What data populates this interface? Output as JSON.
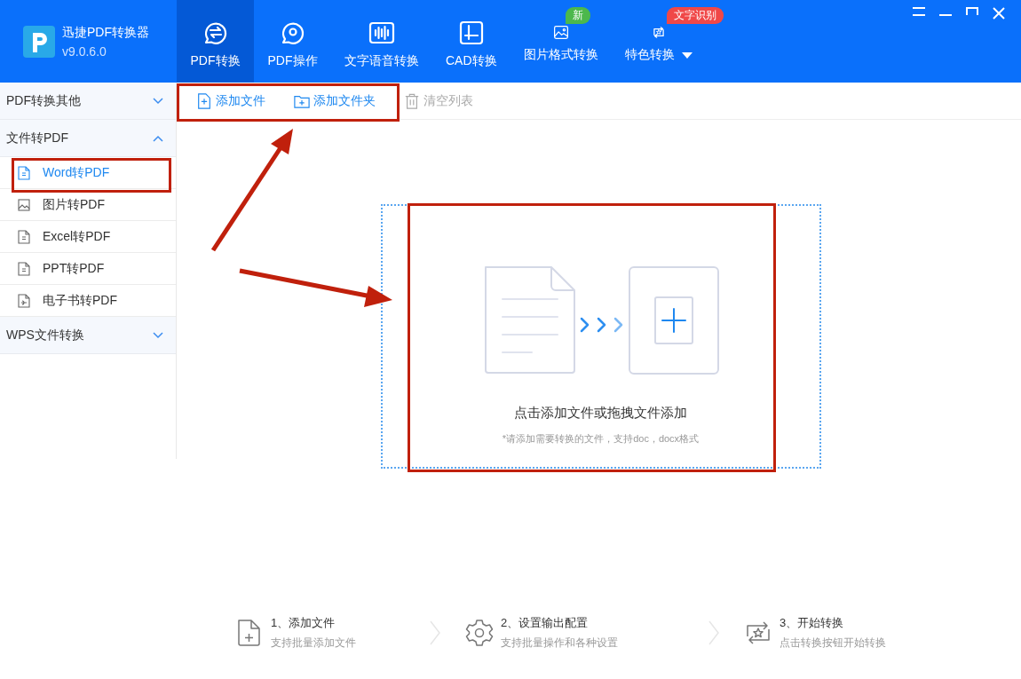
{
  "app": {
    "name": "迅捷PDF转换器",
    "version": "v9.0.6.0"
  },
  "tabs": [
    {
      "label": "PDF转换",
      "selected": true,
      "kind": "convert"
    },
    {
      "label": "PDF操作",
      "selected": false,
      "kind": "gear"
    },
    {
      "label": "文字语音转换",
      "selected": false,
      "kind": "audio"
    },
    {
      "label": "CAD转换",
      "selected": false,
      "kind": "cad"
    },
    {
      "label": "图片格式转换",
      "selected": false,
      "kind": "image",
      "badge": {
        "text": "新",
        "color": "#4cb84c"
      }
    },
    {
      "label": "特色转换",
      "selected": false,
      "kind": "star",
      "dropdown": true,
      "badge": {
        "text": "文字识别",
        "color": "#f04848"
      }
    }
  ],
  "sidebar": [
    {
      "label": "PDF转换其他",
      "expanded": false
    },
    {
      "label": "文件转PDF",
      "expanded": true,
      "children": [
        {
          "label": "Word转PDF",
          "selected": true,
          "kind": "word"
        },
        {
          "label": "图片转PDF",
          "selected": false,
          "kind": "image"
        },
        {
          "label": "Excel转PDF",
          "selected": false,
          "kind": "doc"
        },
        {
          "label": "PPT转PDF",
          "selected": false,
          "kind": "doc"
        },
        {
          "label": "电子书转PDF",
          "selected": false,
          "kind": "ebook"
        }
      ]
    },
    {
      "label": "WPS文件转换",
      "expanded": false
    }
  ],
  "toolbar": [
    {
      "label": "添加文件",
      "disabled": false,
      "kind": "file"
    },
    {
      "label": "添加文件夹",
      "disabled": false,
      "kind": "folder"
    },
    {
      "label": "清空列表",
      "disabled": true,
      "kind": "trash"
    }
  ],
  "dropzone": {
    "title": "点击添加文件或拖拽文件添加",
    "hint": "*请添加需要转换的文件，支持doc，docx格式"
  },
  "steps": [
    {
      "title": "1、添加文件",
      "subtitle": "支持批量添加文件",
      "kind": "add"
    },
    {
      "title": "2、设置输出配置",
      "subtitle": "支持批量操作和各种设置",
      "kind": "gear"
    },
    {
      "title": "3、开始转换",
      "subtitle": "点击转换按钮开始转换",
      "kind": "swap"
    }
  ]
}
